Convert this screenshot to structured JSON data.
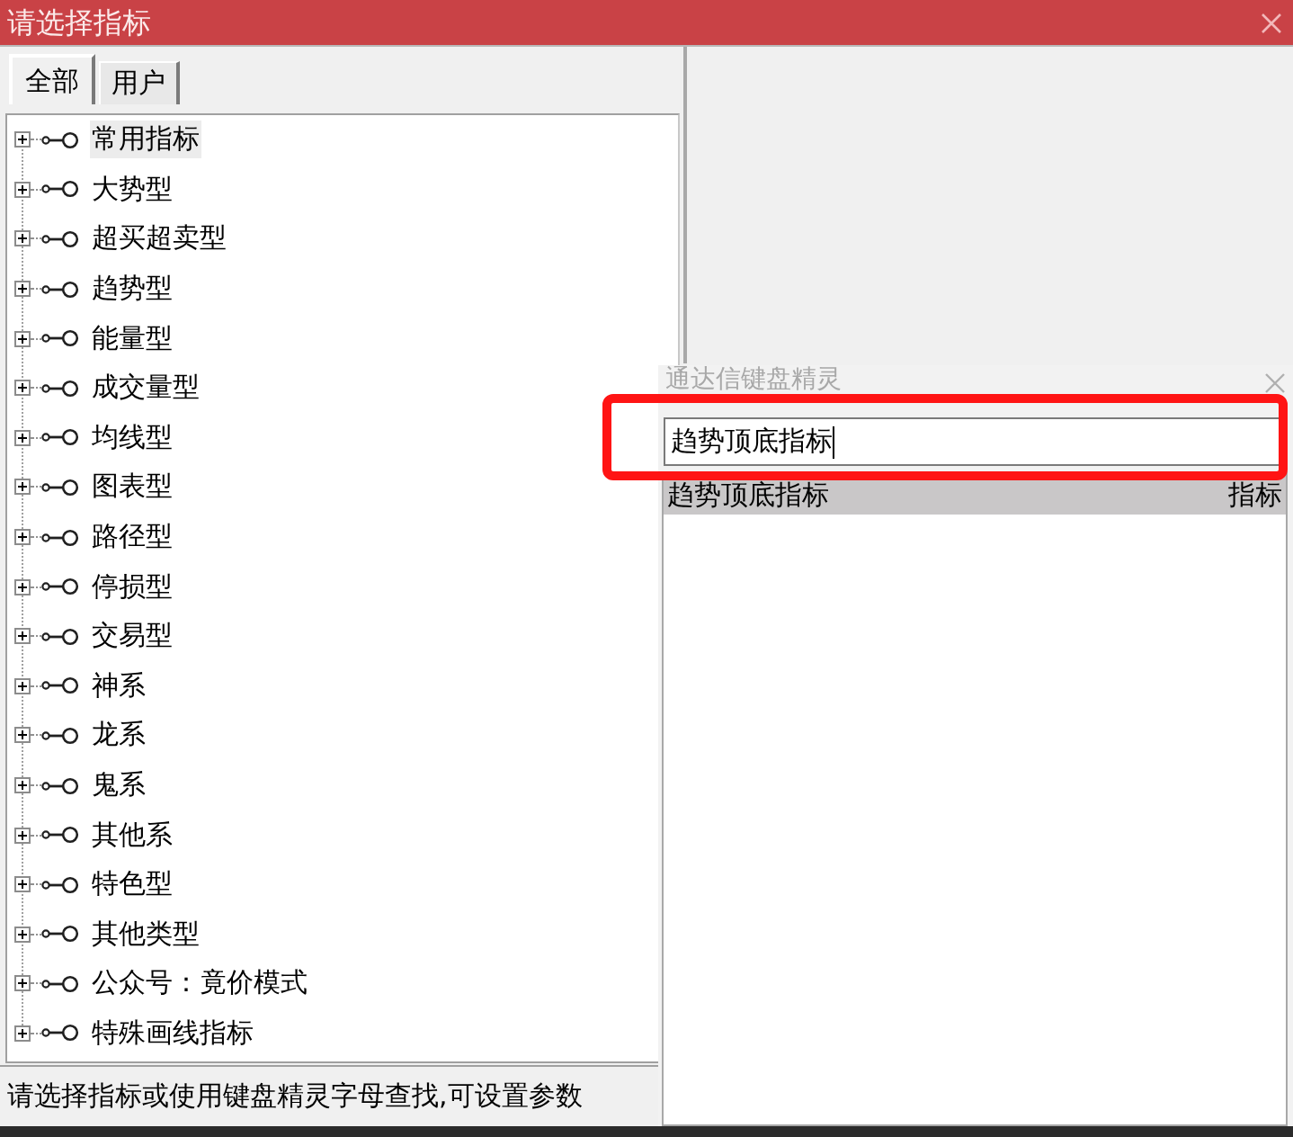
{
  "window": {
    "title": "请选择指标"
  },
  "tabs": [
    {
      "label": "全部",
      "selected": true
    },
    {
      "label": "用户",
      "selected": false
    }
  ],
  "tree": {
    "items": [
      {
        "label": "常用指标",
        "selected": true,
        "expanded": false
      },
      {
        "label": "大势型",
        "selected": false,
        "expanded": false
      },
      {
        "label": "超买超卖型",
        "selected": false,
        "expanded": false
      },
      {
        "label": "趋势型",
        "selected": false,
        "expanded": false
      },
      {
        "label": "能量型",
        "selected": false,
        "expanded": false
      },
      {
        "label": "成交量型",
        "selected": false,
        "expanded": false
      },
      {
        "label": "均线型",
        "selected": false,
        "expanded": false
      },
      {
        "label": "图表型",
        "selected": false,
        "expanded": false
      },
      {
        "label": "路径型",
        "selected": false,
        "expanded": false
      },
      {
        "label": "停损型",
        "selected": false,
        "expanded": false
      },
      {
        "label": "交易型",
        "selected": false,
        "expanded": false
      },
      {
        "label": "神系",
        "selected": false,
        "expanded": false
      },
      {
        "label": "龙系",
        "selected": false,
        "expanded": false
      },
      {
        "label": "鬼系",
        "selected": false,
        "expanded": false
      },
      {
        "label": "其他系",
        "selected": false,
        "expanded": false
      },
      {
        "label": "特色型",
        "selected": false,
        "expanded": false
      },
      {
        "label": "其他类型",
        "selected": false,
        "expanded": false
      },
      {
        "label": "公众号：竟价模式",
        "selected": false,
        "expanded": false
      },
      {
        "label": "特殊画线指标",
        "selected": false,
        "expanded": false
      }
    ]
  },
  "status_bar": "请选择指标或使用键盘精灵字母查找,可设置参数",
  "keyboard_popup": {
    "title": "通达信键盘精灵",
    "input": {
      "value": "趋势顶底指标"
    },
    "results": [
      {
        "name": "趋势顶底指标",
        "type": "指标",
        "selected": true
      }
    ]
  }
}
